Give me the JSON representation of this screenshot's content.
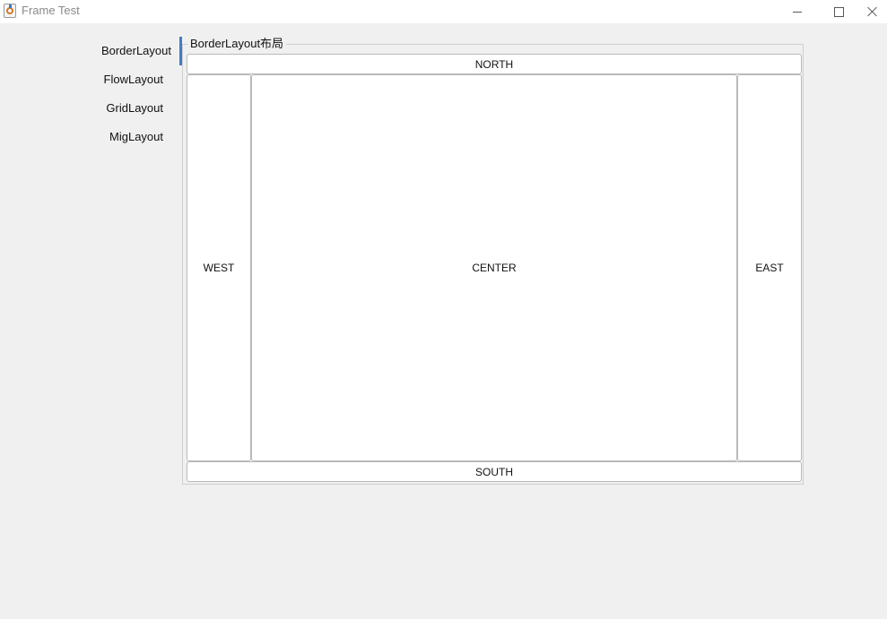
{
  "window": {
    "title": "Frame Test"
  },
  "tabs": [
    {
      "label": "BorderLayout",
      "selected": true
    },
    {
      "label": "FlowLayout",
      "selected": false
    },
    {
      "label": "GridLayout",
      "selected": false
    },
    {
      "label": "MigLayout",
      "selected": false
    }
  ],
  "panel": {
    "group_title": "BorderLayout布局",
    "north": "NORTH",
    "west": "WEST",
    "center": "CENTER",
    "east": "EAST",
    "south": "SOUTH"
  },
  "colors": {
    "selected_tab_indicator": "#3f7ec6",
    "background": "#f0f0f0"
  }
}
